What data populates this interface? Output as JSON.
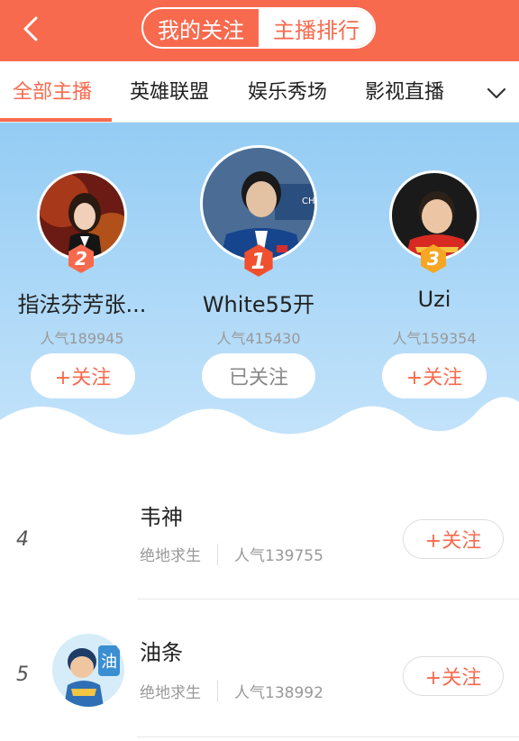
{
  "header": {
    "back_icon": "back-arrow-icon",
    "segments": [
      {
        "label": "我的关注",
        "active": false
      },
      {
        "label": "主播排行",
        "active": true
      }
    ]
  },
  "tabs": {
    "items": [
      "全部主播",
      "英雄联盟",
      "娱乐秀场",
      "影视直播"
    ],
    "active_index": 0,
    "more_icon": "chevron-down-icon"
  },
  "podium": {
    "first": {
      "rank": "1",
      "name": "White55开",
      "popularity": "人气415430",
      "follow_label": "已关注"
    },
    "second": {
      "rank": "2",
      "name": "指法芬芳张...",
      "popularity": "人气189945",
      "follow_label": "+关注"
    },
    "third": {
      "rank": "3",
      "name": "Uzi",
      "popularity": "人气159354",
      "follow_label": "+关注"
    }
  },
  "list": [
    {
      "rank": "4",
      "name": "韦神",
      "category": "绝地求生",
      "popularity": "人气139755",
      "follow_label": "+关注"
    },
    {
      "rank": "5",
      "name": "油条",
      "category": "绝地求生",
      "popularity": "人气138992",
      "follow_label": "+关注"
    }
  ],
  "colors": {
    "accent": "#f86a4e",
    "sky": "#9fd2f5",
    "gold": "#f5a623"
  }
}
